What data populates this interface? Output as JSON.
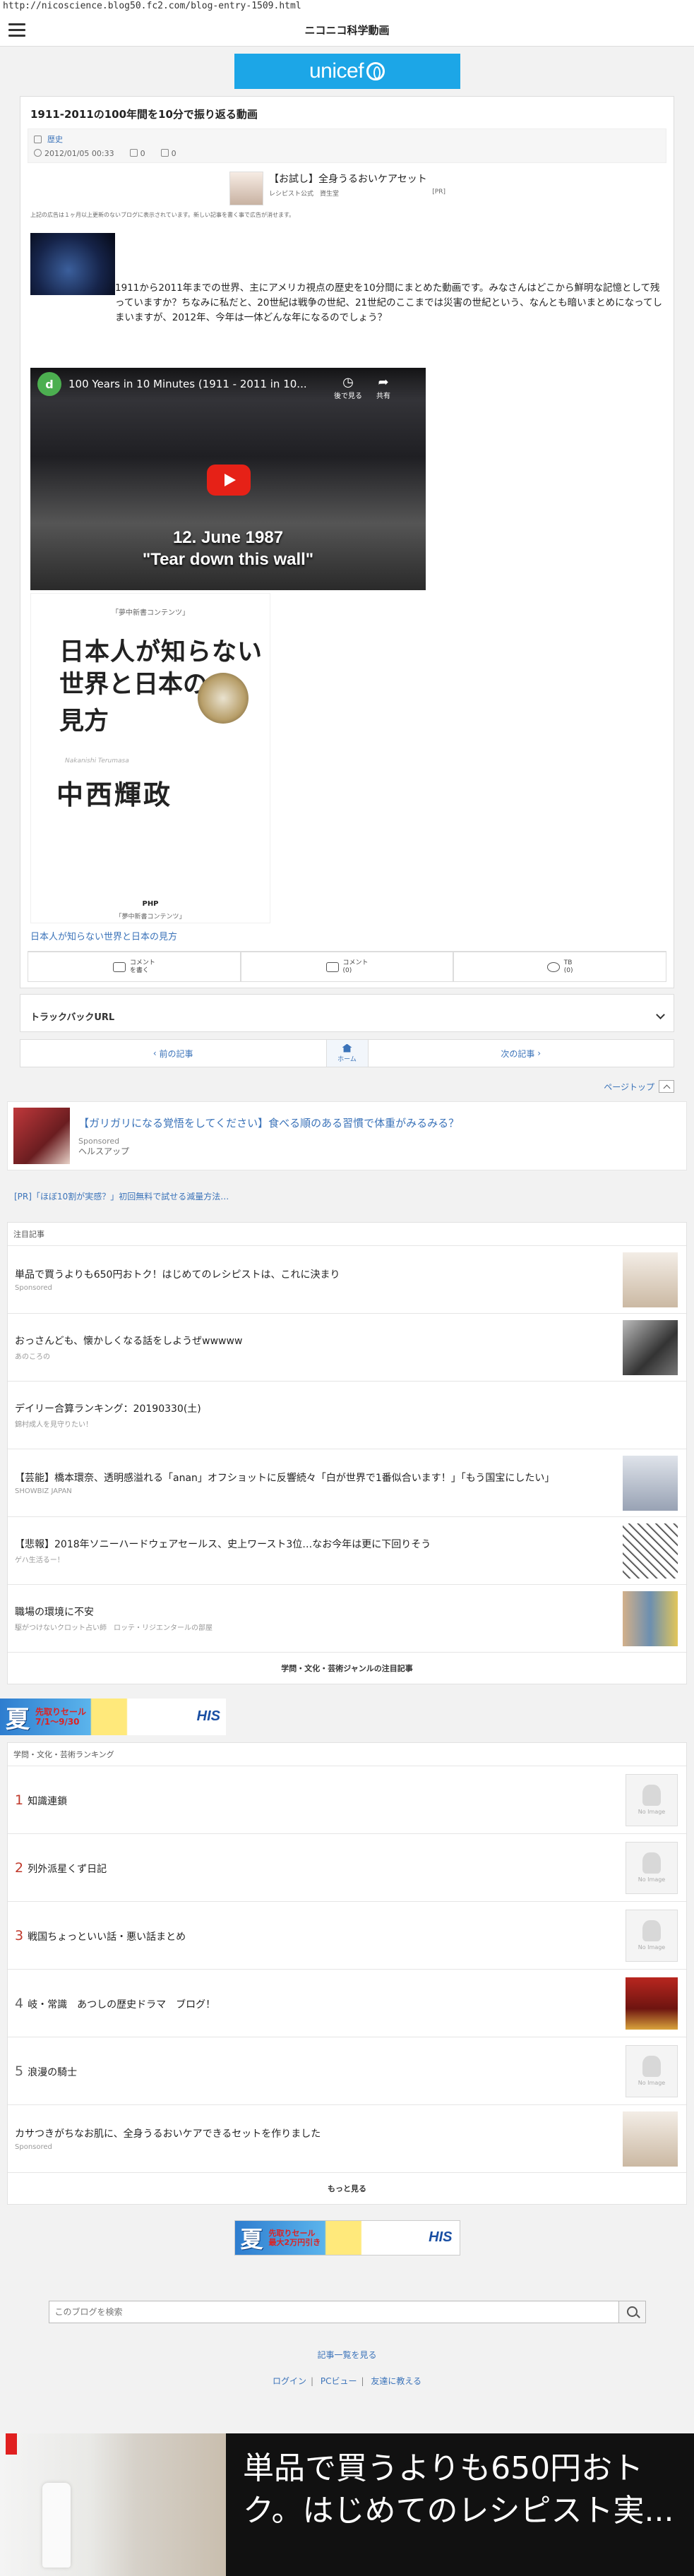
{
  "browser": {
    "url": "http://nicoscience.blog50.fc2.com/blog-entry-1509.html"
  },
  "header": {
    "site_title": "ニコニコ科学動画"
  },
  "banner": {
    "unicef": "unicef"
  },
  "article": {
    "title": "1911-2011の100年間を10分で振り返る動画",
    "category": "歴史",
    "date": "2012/01/05 00:33",
    "trackbacks": "0",
    "comments": "0",
    "pr": {
      "title": "【お試し】全身うるおいケアセット",
      "source": "レシピスト公式　資生堂",
      "badge": "[PR]"
    },
    "small_text": "上記の広告は１ヶ月以上更新のないブログに表示されています。新しい記事を書く事で広告が消せます。",
    "body": "1911から2011年までの世界、主にアメリカ視点の歴史を10分間にまとめた動画です。みなさんはどこから鮮明な記憶として残っていますか？ちなみに私だと、20世紀は戦争の世紀、21世紀のここまでは災害の世紀という、なんとも暗いまとめになってしまいますが、2012年、今年は一体どんな年になるのでしょう？",
    "video": {
      "channel_initial": "d",
      "title": "100 Years in 10 Minutes (1911 - 2011 in 10...",
      "later_label": "後で見る",
      "share_label": "共有",
      "caption_line1": "12. June 1987",
      "caption_line2": "\"Tear down this wall\""
    },
    "book": {
      "series_top": "「夢中新書コンテンツ」",
      "title_line1": "日本人が知らない",
      "title_line2": "世界と日本の",
      "title_line3": "見方",
      "subtitle_en": "Nakanishi Terumasa",
      "author": "中西輝政",
      "publisher": "PHP",
      "series_bottom": "「夢中新書コンテンツ」",
      "link": "日本人が知らない世界と日本の見方"
    },
    "actions": {
      "comment_write": "コメント\nを書く",
      "comments": "コメント\n(0)",
      "tb": "TB\n(0)"
    },
    "trackback_url": "トラックバックURL"
  },
  "pager": {
    "prev": "前の記事",
    "home": "ホーム",
    "next": "次の記事"
  },
  "pagetop": "ページトップ",
  "ad_card": {
    "title": "【ガリガリになる覚悟をしてください】食べる順のある習慣で体重がみるみる？",
    "sponsored": "Sponsored",
    "advertiser": "ヘルスアップ"
  },
  "pr_line": "[PR]「ほぼ10割が実感？」初回無料で試せる減量方法…",
  "attention": {
    "heading": "注目記事",
    "items": [
      {
        "title": "単品で買うよりも650円おトク！はじめてのレシピストは、これに決まり",
        "sub": "Sponsored"
      },
      {
        "title": "おっさんども、懐かしくなる話をしようぜwwwww",
        "sub": "あのころの"
      },
      {
        "title": "デイリー合算ランキング：20190330(土)",
        "sub": "錦村成人を見守りたい！"
      },
      {
        "title": "【芸能】橋本環奈、透明感溢れる「anan」オフショットに反響続々「白が世界で1番似合います！」「もう国宝にしたい」",
        "sub": "SHOWBIZ JAPAN"
      },
      {
        "title": "【悲報】2018年ソニーハードウェアセールス、史上ワースト3位…なお今年は更に下回りそう",
        "sub": "ゲハ生活るー！"
      },
      {
        "title": "職場の環境に不安",
        "sub": "駆がつけないクロット占い師　ロッテ・リジエンタールの部屋"
      }
    ],
    "footer": "学問・文化・芸術ジャンルの注目記事"
  },
  "his_banner": {
    "kanji": "夏",
    "sale1": "先取りセール",
    "sale2": "7/1～9/30",
    "sale3": "最大2万円引き",
    "brand": "HIS"
  },
  "ranking": {
    "heading": "学問・文化・芸術ランキング",
    "items": [
      {
        "num": "1",
        "title": "知識連鎖",
        "noimage": "No Image"
      },
      {
        "num": "2",
        "title": "列外派星くず日記",
        "noimage": "No Image"
      },
      {
        "num": "3",
        "title": "戦国ちょっといい話・悪い話まとめ",
        "noimage": "No Image"
      },
      {
        "num": "4",
        "title": "岐・常識　あつしの歴史ドラマ　ブログ！",
        "noimage": ""
      },
      {
        "num": "5",
        "title": "浪漫の騎士",
        "noimage": "No Image"
      }
    ],
    "sponsored_item": {
      "title": "カサつきがちなお肌に、全身うるおいケアできるセットを作りました",
      "sub": "Sponsored"
    },
    "more": "もっと見る"
  },
  "search": {
    "placeholder": "このブログを検索"
  },
  "footer": {
    "list_link": "記事一覧を見る",
    "login": "ログイン",
    "pc_view": "PCビュー",
    "teach": "友達に教える",
    "sep": "|"
  },
  "bottom_ad": {
    "text": "単品で買うよりも650円おトク。はじめてのレシピスト実..."
  },
  "colors": {
    "accent": "#3b73b9",
    "unicef": "#1ca6e7",
    "rank_top": "#c0392b",
    "play": "#e62117"
  }
}
